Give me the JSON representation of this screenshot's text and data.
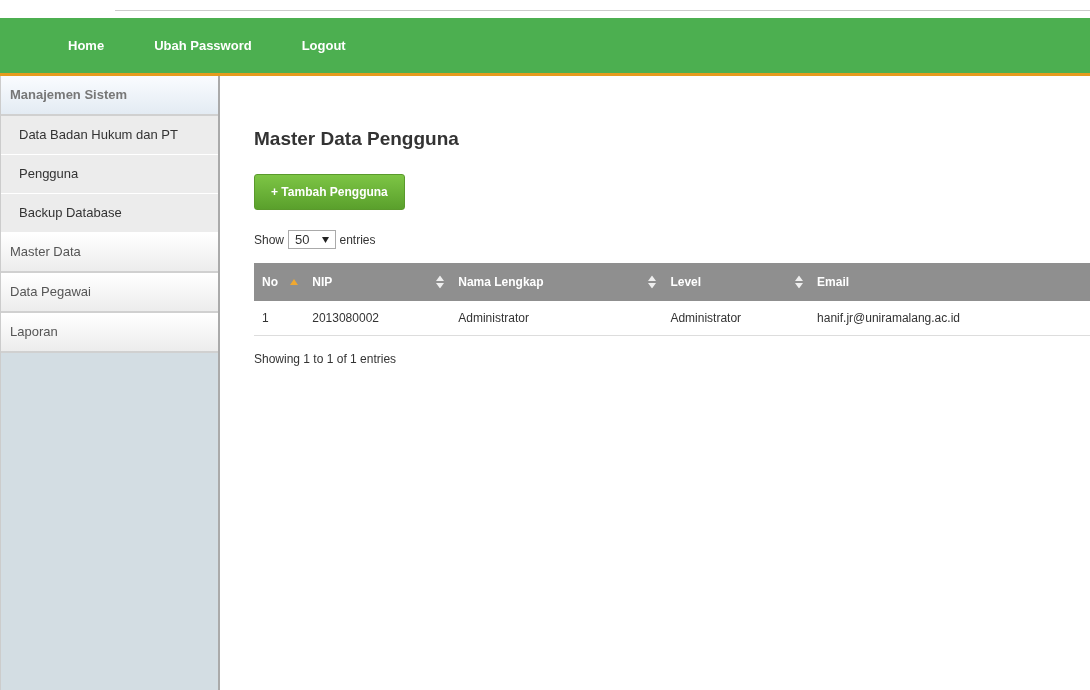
{
  "nav": [
    {
      "label": "Home"
    },
    {
      "label": "Ubah Password"
    },
    {
      "label": "Logout"
    }
  ],
  "sidebar": {
    "items": [
      {
        "label": "Manajemen Sistem",
        "expanded": true,
        "children": [
          {
            "label": "Data Badan Hukum dan PT"
          },
          {
            "label": "Pengguna"
          },
          {
            "label": "Backup Database"
          }
        ]
      },
      {
        "label": "Master Data",
        "expanded": false
      },
      {
        "label": "Data Pegawai",
        "expanded": false
      },
      {
        "label": "Laporan",
        "expanded": false
      }
    ]
  },
  "page": {
    "title": "Master Data Pengguna",
    "add_button": "+ Tambah Pengguna",
    "length": {
      "before": "Show",
      "value": "50",
      "after": "entries"
    },
    "table": {
      "columns": [
        {
          "label": "No",
          "sorted_ascending": true
        },
        {
          "label": "NIP",
          "sorted_ascending": false
        },
        {
          "label": "Nama Lengkap",
          "sorted_ascending": false
        },
        {
          "label": "Level",
          "sorted_ascending": false
        },
        {
          "label": "Email"
        }
      ],
      "rows": [
        [
          "1",
          "2013080002",
          "Administrator",
          "Administrator",
          "hanif.jr@uniramalang.ac.id"
        ]
      ]
    },
    "info": "Showing 1 to 1 of 1 entries"
  }
}
